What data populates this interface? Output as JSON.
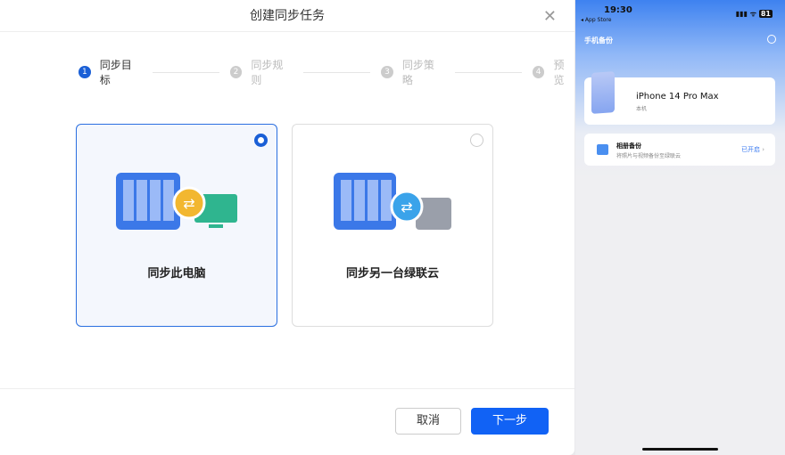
{
  "dialog": {
    "title": "创建同步任务",
    "steps": [
      {
        "num": "1",
        "label": "同步目标"
      },
      {
        "num": "2",
        "label": "同步规则"
      },
      {
        "num": "3",
        "label": "同步策略"
      },
      {
        "num": "4",
        "label": "预览"
      }
    ],
    "options": [
      {
        "label": "同步此电脑",
        "selected": true
      },
      {
        "label": "同步另一台绿联云",
        "selected": false
      }
    ],
    "cancel": "取消",
    "next": "下一步"
  },
  "phone": {
    "time": "19:30",
    "back": "◂ App Store",
    "battery": "81",
    "title": "手机备份",
    "device": "iPhone 14 Pro Max",
    "device_sub": "本机",
    "row_title": "相册备份",
    "row_sub": "将照片与视频备份至绿联云",
    "row_status": "已开启"
  }
}
